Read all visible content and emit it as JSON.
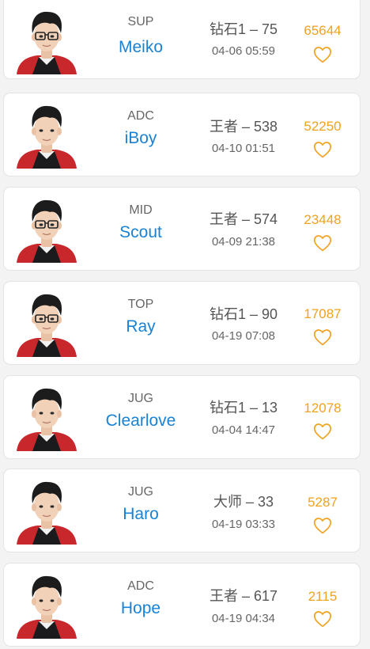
{
  "players": [
    {
      "role": "SUP",
      "name": "Meiko",
      "rank": "钻石1 – 75",
      "time": "04-06 05:59",
      "score": "65644",
      "glasses": true
    },
    {
      "role": "ADC",
      "name": "iBoy",
      "rank": "王者 – 538",
      "time": "04-10 01:51",
      "score": "52250",
      "glasses": false
    },
    {
      "role": "MID",
      "name": "Scout",
      "rank": "王者 – 574",
      "time": "04-09 21:38",
      "score": "23448",
      "glasses": true
    },
    {
      "role": "TOP",
      "name": "Ray",
      "rank": "钻石1 – 90",
      "time": "04-19 07:08",
      "score": "17087",
      "glasses": true
    },
    {
      "role": "JUG",
      "name": "Clearlove",
      "rank": "钻石1 – 13",
      "time": "04-04 14:47",
      "score": "12078",
      "glasses": false
    },
    {
      "role": "JUG",
      "name": "Haro",
      "rank": "大师 – 33",
      "time": "04-19 03:33",
      "score": "5287",
      "glasses": false
    },
    {
      "role": "ADC",
      "name": "Hope",
      "rank": "王者 – 617",
      "time": "04-19 04:34",
      "score": "2115",
      "glasses": false
    }
  ],
  "icons": {
    "like": "heart-outline-icon"
  },
  "colors": {
    "name": "#1a82d4",
    "score": "#f0a21f",
    "heart": "#f0a21f",
    "jersey_red": "#c8282c",
    "jersey_dark": "#1b1b1d"
  }
}
